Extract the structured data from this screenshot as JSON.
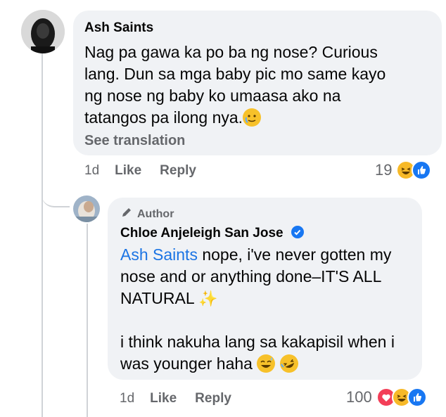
{
  "comment": {
    "author": "Ash Saints",
    "text_lines": [
      "Nag pa gawa ka po ba ng nose? Curious",
      "lang. Dun sa mga baby pic mo same kayo",
      "ng nose ng baby ko  umaasa ako na",
      "tatangos pa ilong nya."
    ],
    "see_translation": "See translation",
    "time": "1d",
    "like_label": "Like",
    "reply_label": "Reply",
    "reaction_count": "19",
    "reactions": [
      "haha-emoji",
      "like-icon"
    ]
  },
  "reply": {
    "badge": "Author",
    "author": "Chloe Anjeleigh San Jose",
    "mention": "Ash Saints",
    "text_first": " nope, i've never gotten my",
    "text_lines": [
      "nose and or anything done–IT'S ALL",
      "NATURAL "
    ],
    "text_lines_2": [
      "i think nakuha lang sa kakapisil when i",
      "was younger haha "
    ],
    "time": "1d",
    "like_label": "Like",
    "reply_label": "Reply",
    "reaction_count": "100",
    "reactions": [
      "love-icon",
      "haha-emoji",
      "like-icon"
    ]
  }
}
